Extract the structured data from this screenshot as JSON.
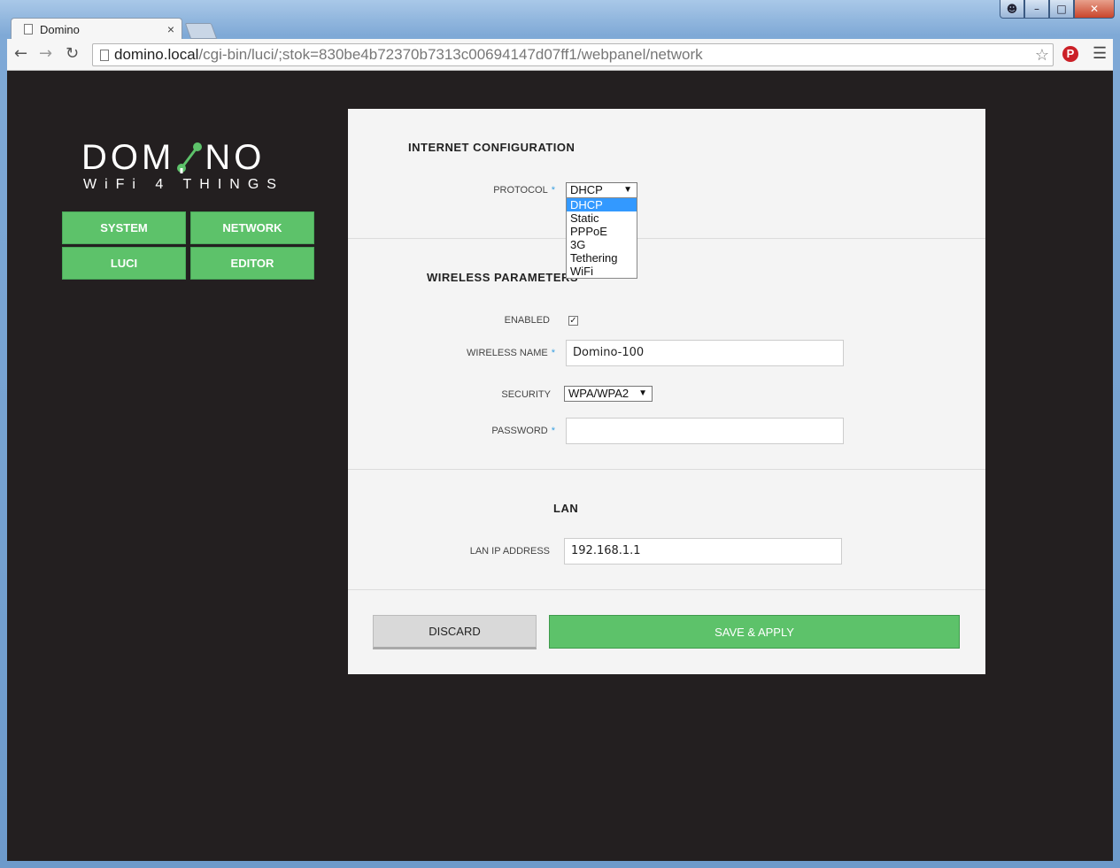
{
  "browser": {
    "tab_title": "Domino",
    "tab_close": "×",
    "url_host": "domino.local",
    "url_path": "/cgi-bin/luci/;stok=830be4b72370b7313c00694147d07ff1/webpanel/network",
    "icons": [
      "back-icon",
      "forward-icon",
      "reload-icon",
      "star-icon",
      "pinterest-icon",
      "menu-icon"
    ]
  },
  "logo": {
    "main_left": "DOM",
    "main_right": "NO",
    "tagline": "WiFi 4 THINGS",
    "accent_color": "#5dc26a"
  },
  "nav": {
    "system": "SYSTEM",
    "network": "NETWORK",
    "luci": "LUCI",
    "editor": "EDITOR"
  },
  "internet": {
    "title": "INTERNET CONFIGURATION",
    "protocol_label": "PROTOCOL",
    "protocol_value": "DHCP",
    "protocol_options": [
      "DHCP",
      "Static",
      "PPPoE",
      "3G",
      "Tethering",
      "WiFi"
    ]
  },
  "wireless": {
    "title": "WIRELESS PARAMETERS",
    "enabled_label": "ENABLED",
    "enabled": true,
    "name_label": "WIRELESS NAME",
    "name_value": "Domino-100",
    "security_label": "SECURITY",
    "security_value": "WPA/WPA2",
    "password_label": "PASSWORD",
    "password_value": ""
  },
  "lan": {
    "title": "LAN",
    "ip_label": "LAN IP ADDRESS",
    "ip_value": "192.168.1.1"
  },
  "actions": {
    "discard": "DISCARD",
    "save": "SAVE & APPLY"
  },
  "required_mark": "*"
}
